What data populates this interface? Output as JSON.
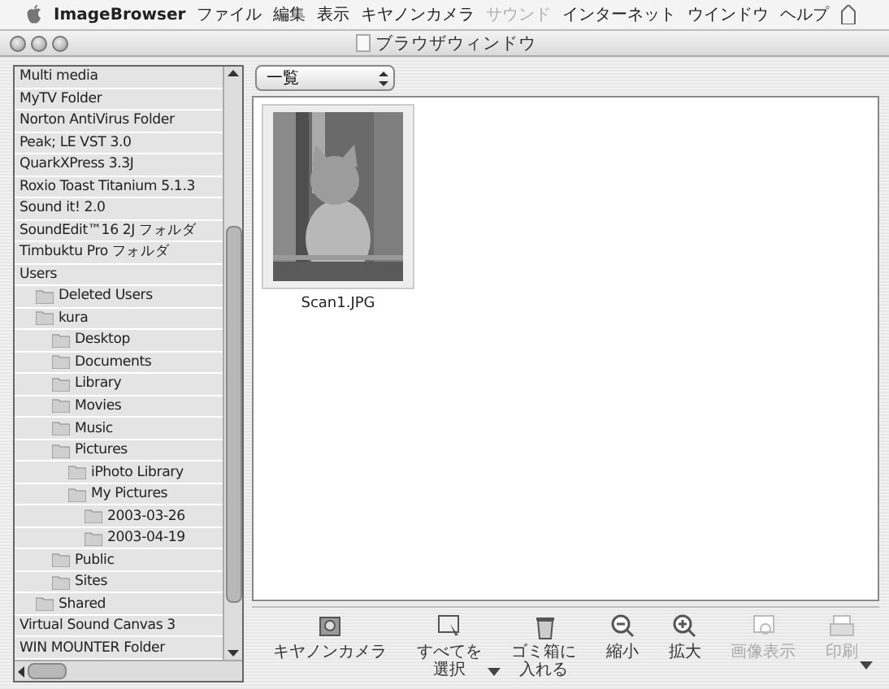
{
  "menu_bar": {
    "app_name": "ImageBrowser",
    "items": [
      {
        "label": "ファイル",
        "disabled": false
      },
      {
        "label": "編集",
        "disabled": false
      },
      {
        "label": "表示",
        "disabled": false
      },
      {
        "label": "キヤノンカメラ",
        "disabled": false
      },
      {
        "label": "サウンド",
        "disabled": true
      },
      {
        "label": "インターネット",
        "disabled": false
      },
      {
        "label": "ウインドウ",
        "disabled": false
      },
      {
        "label": "ヘルプ",
        "disabled": false
      }
    ]
  },
  "window": {
    "title": "ブラウザウィンドウ"
  },
  "folder_list": {
    "items": [
      {
        "label": "Multi media"
      },
      {
        "label": "MyTV Folder"
      },
      {
        "label": "Norton AntiVirus Folder"
      },
      {
        "label": "Peak; LE VST 3.0"
      },
      {
        "label": "QuarkXPress 3.3J"
      },
      {
        "label": "Roxio Toast Titanium 5.1.3"
      },
      {
        "label": "Sound it! 2.0"
      },
      {
        "label": "SoundEdit™16  2J フォルダ"
      },
      {
        "label": "Timbuktu Pro フォルダ"
      },
      {
        "label": "Users",
        "children": [
          {
            "label": "Deleted Users"
          },
          {
            "label": "kura",
            "children": [
              {
                "label": "Desktop"
              },
              {
                "label": "Documents"
              },
              {
                "label": "Library"
              },
              {
                "label": "Movies"
              },
              {
                "label": "Music"
              },
              {
                "label": "Pictures",
                "children": [
                  {
                    "label": "iPhoto Library"
                  },
                  {
                    "label": "My Pictures",
                    "children": [
                      {
                        "label": "2003-03-26"
                      },
                      {
                        "label": "2003-04-19"
                      }
                    ]
                  }
                ]
              },
              {
                "label": "Public"
              },
              {
                "label": "Sites"
              }
            ]
          },
          {
            "label": "Shared"
          }
        ]
      },
      {
        "label": "Virtual Sound Canvas 3"
      },
      {
        "label": "WIN MOUNTER Folder"
      }
    ]
  },
  "view_popup": {
    "value": "一覧"
  },
  "thumbnails": [
    {
      "kind": "picture",
      "filename": "Scan1.JPG"
    }
  ],
  "toolbar": {
    "buttons": [
      {
        "lines": [
          "キヤノンカメラ"
        ],
        "disabled": false,
        "has_menu": false
      },
      {
        "lines": [
          "すべてを",
          "選択"
        ],
        "disabled": false,
        "has_menu": true
      },
      {
        "lines": [
          "ゴミ箱に",
          "入れる"
        ],
        "disabled": false,
        "has_menu": false
      },
      {
        "lines": [
          "縮小"
        ],
        "disabled": false,
        "has_menu": false
      },
      {
        "lines": [
          "拡大"
        ],
        "disabled": false,
        "has_menu": false
      },
      {
        "lines": [
          "画像表示"
        ],
        "disabled": true,
        "has_menu": false
      },
      {
        "lines": [
          "印刷"
        ],
        "disabled": true,
        "has_menu": false
      }
    ]
  }
}
